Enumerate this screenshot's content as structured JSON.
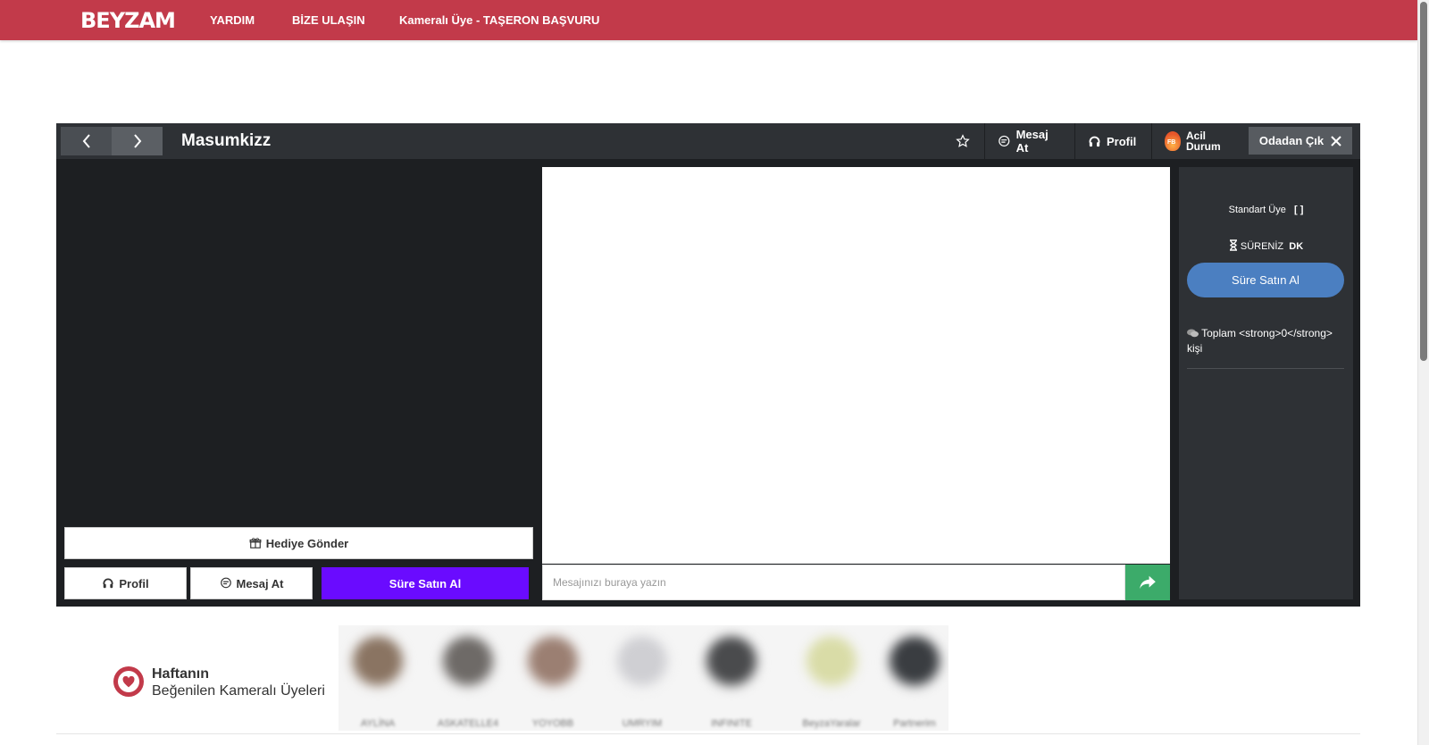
{
  "nav": {
    "logo": "BEYZAM",
    "links": [
      "YARDIM",
      "BİZE ULAŞIN",
      "Kameralı Üye - TAŞERON BAŞVURU"
    ]
  },
  "room": {
    "title": "Masumkizz",
    "header": {
      "message_label": "Mesaj At",
      "profile_label": "Profil",
      "emergency_label_1": "Acil",
      "emergency_label_2": "Durum",
      "fire_badge": "FB",
      "leave_label": "Odadan Çık"
    },
    "gift_label": "Hediye Gönder",
    "profile_label": "Profil",
    "message_label": "Mesaj At",
    "buy_label": "Süre Satın Al",
    "chat_placeholder": "Mesajınızı buraya yazın",
    "side": {
      "member_type": "Standart Üye",
      "member_bracket": "[ ]",
      "time_label": "SÜRENİZ",
      "time_unit": "DK",
      "buy_label": "Süre Satın Al",
      "total_text": "Toplam <strong>0</strong> kişi"
    }
  },
  "weekly": {
    "title": "Haftanın",
    "subtitle": "Beğenilen Kameralı Üyeleri",
    "members": [
      {
        "name": "AYLİNA",
        "color": "#8a7462"
      },
      {
        "name": "ASKATELLE4",
        "color": "#6e6a67"
      },
      {
        "name": "YOYOBB",
        "color": "#9b7f72"
      },
      {
        "name": "UMRYIM",
        "color": "#cfcfd3"
      },
      {
        "name": "INFINITE",
        "color": "#4a4b4d"
      },
      {
        "name": "BeyzaYaralar",
        "color": "#d9dca7"
      },
      {
        "name": "Partnerim",
        "color": "#3a3d41"
      }
    ]
  },
  "colors": {
    "brand": "#c23a4a",
    "buy_purple": "#6a0bff",
    "side_buy_blue": "#4b7fc1",
    "send_green": "#3cab6a"
  }
}
